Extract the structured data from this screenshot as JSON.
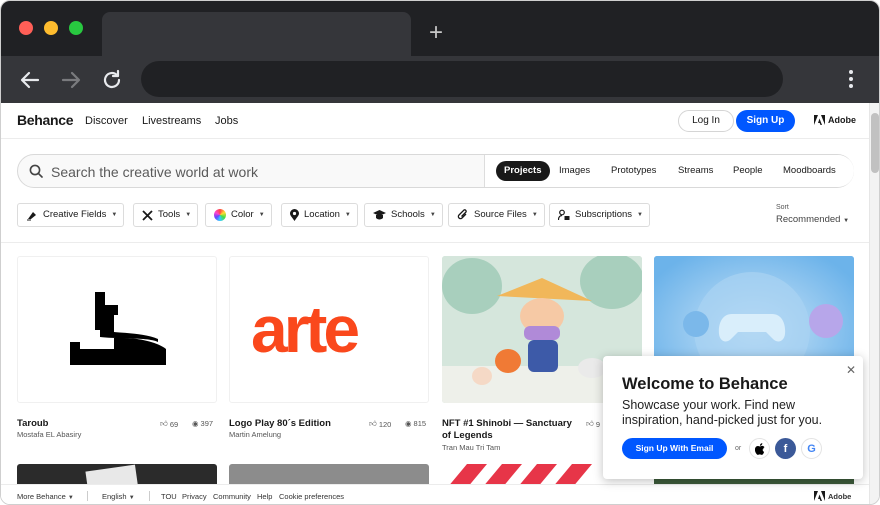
{
  "browser": {
    "new_tab_label": "+"
  },
  "header": {
    "logo": "Behance",
    "nav": [
      "Discover",
      "Livestreams",
      "Jobs"
    ],
    "login_label": "Log In",
    "signup_label": "Sign Up",
    "adobe_label": "Adobe"
  },
  "search": {
    "placeholder": "Search the creative world at work",
    "segments": [
      "Projects",
      "Images",
      "Prototypes",
      "Streams",
      "People",
      "Moodboards"
    ],
    "active_segment": "Projects"
  },
  "filters": [
    "Creative Fields",
    "Tools",
    "Color",
    "Location",
    "Schools",
    "Source Files",
    "Subscriptions"
  ],
  "sort": {
    "label": "Sort",
    "value": "Recommended"
  },
  "cards": [
    {
      "title": "Taroub",
      "author": "Mostafa EL Abasiry",
      "likes": "69",
      "views": "397"
    },
    {
      "title": "Logo Play 80´s Edition",
      "author": "Martin Amelung",
      "likes": "120",
      "views": "815"
    },
    {
      "title": "NFT #1 Shinobi — Sanctuary of Legends",
      "author": "Tran Mau Tri Tam",
      "likes": "9",
      "views": ""
    },
    {
      "title": "",
      "author": "",
      "likes": "",
      "views": ""
    }
  ],
  "card_art": {
    "arte_text": "arte"
  },
  "footer": {
    "more": "More Behance",
    "language": "English",
    "links": [
      "TOU",
      "Privacy",
      "Community",
      "Help",
      "Cookie preferences"
    ],
    "adobe_label": "Adobe"
  },
  "popup": {
    "title": "Welcome to Behance",
    "text": "Showcase your work. Find new inspiration, hand-picked just for you.",
    "button": "Sign Up With Email",
    "or": "or",
    "google": "G",
    "facebook": "f"
  },
  "colors": {
    "brand_blue": "#0057ff",
    "arte_orange": "#fa481c"
  }
}
